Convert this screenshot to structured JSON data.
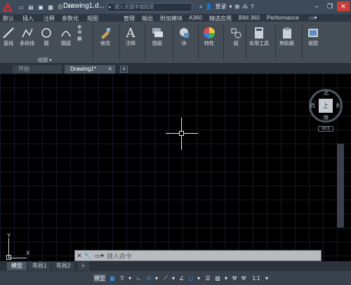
{
  "title_bar": {
    "doc_title": "Drawing1.d...",
    "search_placeholder": "键入关键字或短语",
    "login_label": "登录",
    "close_symbol": "✕"
  },
  "ribbon_tabs": [
    {
      "label": "默认"
    },
    {
      "label": "插入"
    },
    {
      "label": "注释"
    },
    {
      "label": "参数化"
    },
    {
      "label": "视图"
    },
    {
      "label": "管理"
    },
    {
      "label": "输出"
    },
    {
      "label": "附加模块"
    },
    {
      "label": "A360"
    },
    {
      "label": "精选应用"
    },
    {
      "label": "BIM 360"
    },
    {
      "label": "Performance"
    }
  ],
  "ribbon": {
    "tools": [
      {
        "label": "直线"
      },
      {
        "label": "多段线"
      },
      {
        "label": "圆"
      },
      {
        "label": "圆弧"
      },
      {
        "label": "修改"
      },
      {
        "label": "注释"
      },
      {
        "label": "图层"
      },
      {
        "label": "块"
      },
      {
        "label": "特性"
      },
      {
        "label": "组"
      },
      {
        "label": "实用工具"
      },
      {
        "label": "剪贴板"
      },
      {
        "label": "视图"
      }
    ],
    "panel_draw_label": "绘图"
  },
  "document_tabs": {
    "start": "开始",
    "active": "Drawing1*",
    "add": "+"
  },
  "viewcube": {
    "face": "上",
    "north": "北",
    "south": "南",
    "east": "东",
    "west": "西",
    "wcs": "WCS"
  },
  "ucs": {
    "x": "X",
    "y": "Y"
  },
  "command_line": {
    "placeholder": "键入命令"
  },
  "layout_tabs": [
    {
      "label": "模型"
    },
    {
      "label": "布局1"
    },
    {
      "label": "布局2"
    },
    {
      "label": "+"
    }
  ],
  "status_bar": {
    "model": "模型",
    "scale": "1:1"
  },
  "colors": {
    "accent": "#3aa0ff",
    "close": "#c9403a",
    "logo": "#d3302c"
  }
}
